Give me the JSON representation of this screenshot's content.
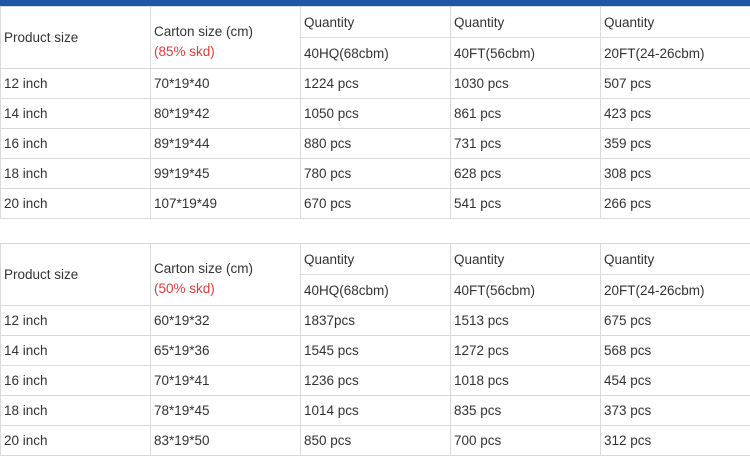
{
  "tables": [
    {
      "header": {
        "product_size": "Product size",
        "carton_size": "Carton size (cm)",
        "carton_note": "(85% skd)",
        "quantity_label": "Quantity",
        "container_1": "40HQ(68cbm)",
        "container_2": "40FT(56cbm)",
        "container_3": "20FT(24-26cbm)"
      },
      "rows": [
        [
          "12 inch",
          "70*19*40",
          "1224 pcs",
          "1030 pcs",
          "507 pcs"
        ],
        [
          "14 inch",
          "80*19*42",
          "1050 pcs",
          "861 pcs",
          "423 pcs"
        ],
        [
          "16 inch",
          "89*19*44",
          "880 pcs",
          "731 pcs",
          "359 pcs"
        ],
        [
          "18 inch",
          "99*19*45",
          "780 pcs",
          "628 pcs",
          "308 pcs"
        ],
        [
          "20 inch",
          "107*19*49",
          "670 pcs",
          "541 pcs",
          "266 pcs"
        ]
      ]
    },
    {
      "header": {
        "product_size": "Product size",
        "carton_size": "Carton size (cm)",
        "carton_note": "(50% skd)",
        "quantity_label": "Quantity",
        "container_1": "40HQ(68cbm)",
        "container_2": "40FT(56cbm)",
        "container_3": "20FT(24-26cbm)"
      },
      "rows": [
        [
          "12 inch",
          "60*19*32",
          "1837pcs",
          "1513 pcs",
          "675 pcs"
        ],
        [
          "14 inch",
          "65*19*36",
          "1545 pcs",
          "1272 pcs",
          "568 pcs"
        ],
        [
          "16 inch",
          "70*19*41",
          "1236 pcs",
          "1018 pcs",
          "454 pcs"
        ],
        [
          "18 inch",
          "78*19*45",
          "1014 pcs",
          "835 pcs",
          "373 pcs"
        ],
        [
          "20 inch",
          "83*19*50",
          "850 pcs",
          "700 pcs",
          "312 pcs"
        ]
      ]
    }
  ],
  "colors": {
    "accent_bar": "#1f56a6",
    "note_red": "#e23b3b",
    "border": "#d9d9d9",
    "text": "#333333"
  }
}
